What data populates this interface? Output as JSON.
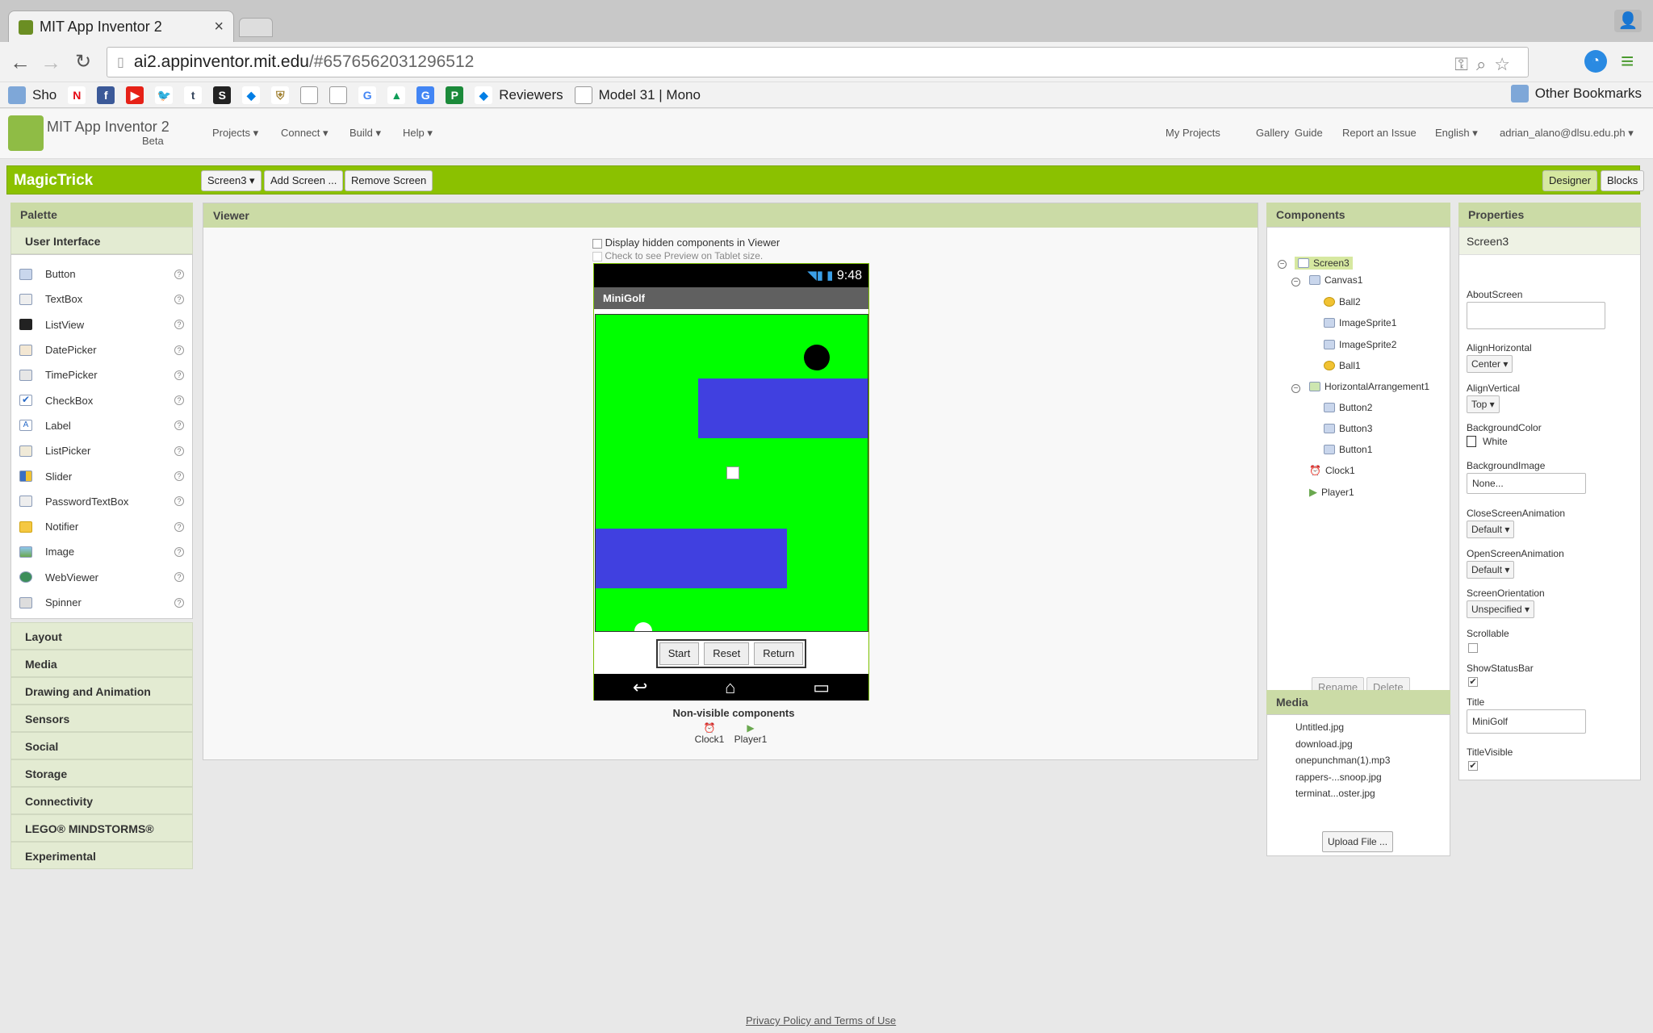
{
  "browser": {
    "tab_title": "MIT App Inventor 2",
    "tab_close": "×",
    "url_host": "ai2.appinventor.mit.edu",
    "url_path": "/#6576562031296512",
    "bookmarks": [
      {
        "label": "Sho",
        "icon": "folder-icon"
      },
      {
        "label": "",
        "icon": "netflix-icon"
      },
      {
        "label": "",
        "icon": "facebook-icon"
      },
      {
        "label": "",
        "icon": "youtube-icon"
      },
      {
        "label": "",
        "icon": "twitter-icon"
      },
      {
        "label": "",
        "icon": "tumblr-icon"
      },
      {
        "label": "",
        "icon": "squarespace-icon"
      },
      {
        "label": "",
        "icon": "dropbox-icon"
      },
      {
        "label": "",
        "icon": "shield-icon"
      },
      {
        "label": "",
        "icon": "page-icon"
      },
      {
        "label": "",
        "icon": "page-icon"
      },
      {
        "label": "",
        "icon": "google-icon"
      },
      {
        "label": "",
        "icon": "drive-icon"
      },
      {
        "label": "",
        "icon": "translate-icon"
      },
      {
        "label": "",
        "icon": "p-icon"
      },
      {
        "label": "Reviewers",
        "icon": "dropbox-icon"
      },
      {
        "label": "Model 31 | Mono",
        "icon": "page-icon"
      }
    ],
    "other_bookmarks": "Other Bookmarks"
  },
  "app": {
    "name": "MIT App Inventor 2",
    "beta": "Beta",
    "menus_left": [
      "Projects ▾",
      "Connect ▾",
      "Build ▾",
      "Help ▾"
    ],
    "menus_right": [
      "My Projects",
      "Gallery",
      "Guide",
      "Report an Issue",
      "English ▾",
      "adrian_alano@dlsu.edu.ph ▾"
    ]
  },
  "project": {
    "name": "MagicTrick",
    "screen_select": "Screen3 ▾",
    "add_screen": "Add Screen ...",
    "remove_screen": "Remove Screen",
    "designer": "Designer",
    "blocks": "Blocks"
  },
  "palette": {
    "title": "Palette",
    "open_section": "User Interface",
    "items": [
      "Button",
      "TextBox",
      "ListView",
      "DatePicker",
      "TimePicker",
      "CheckBox",
      "Label",
      "ListPicker",
      "Slider",
      "PasswordTextBox",
      "Notifier",
      "Image",
      "WebViewer",
      "Spinner"
    ],
    "help": "?",
    "sections": [
      "Layout",
      "Media",
      "Drawing and Animation",
      "Sensors",
      "Social",
      "Storage",
      "Connectivity",
      "LEGO® MINDSTORMS®",
      "Experimental"
    ]
  },
  "viewer": {
    "title": "Viewer",
    "hidden_label": "Display hidden components in Viewer",
    "tablet_label": "Check to see Preview on Tablet size.",
    "status_time": "9:48",
    "screen_title": "MiniGolf",
    "buttons": [
      "Start",
      "Reset",
      "Return"
    ],
    "nonvisible_title": "Non-visible components",
    "nonvisible": [
      "Clock1",
      "Player1"
    ]
  },
  "components": {
    "title": "Components",
    "tree": [
      "Screen3",
      "Canvas1",
      "Ball2",
      "ImageSprite1",
      "ImageSprite2",
      "Ball1",
      "HorizontalArrangement1",
      "Button2",
      "Button3",
      "Button1",
      "Clock1",
      "Player1"
    ],
    "rename": "Rename",
    "delete": "Delete"
  },
  "media": {
    "title": "Media",
    "files": [
      "Untitled.jpg",
      "download.jpg",
      "onepunchman(1).mp3",
      "rappers-...snoop.jpg",
      "terminat...oster.jpg"
    ],
    "upload": "Upload File ..."
  },
  "properties": {
    "title": "Properties",
    "screen": "Screen3",
    "about_label": "AboutScreen",
    "align_h_label": "AlignHorizontal",
    "align_h": "Center ▾",
    "align_v_label": "AlignVertical",
    "align_v": "Top ▾",
    "bgcolor_label": "BackgroundColor",
    "bgcolor": "White",
    "bgimage_label": "BackgroundImage",
    "bgimage": "None...",
    "close_anim_label": "CloseScreenAnimation",
    "close_anim": "Default ▾",
    "open_anim_label": "OpenScreenAnimation",
    "open_anim": "Default ▾",
    "orient_label": "ScreenOrientation",
    "orient": "Unspecified ▾",
    "scrollable_label": "Scrollable",
    "statusbar_label": "ShowStatusBar",
    "title_label": "Title",
    "title_value": "MiniGolf",
    "titlevisible_label": "TitleVisible"
  },
  "footer": "Privacy Policy and Terms of Use",
  "colors": {
    "green_bar": "#8bc100",
    "canvas": "#00ff00",
    "wall": "#4040e0"
  }
}
